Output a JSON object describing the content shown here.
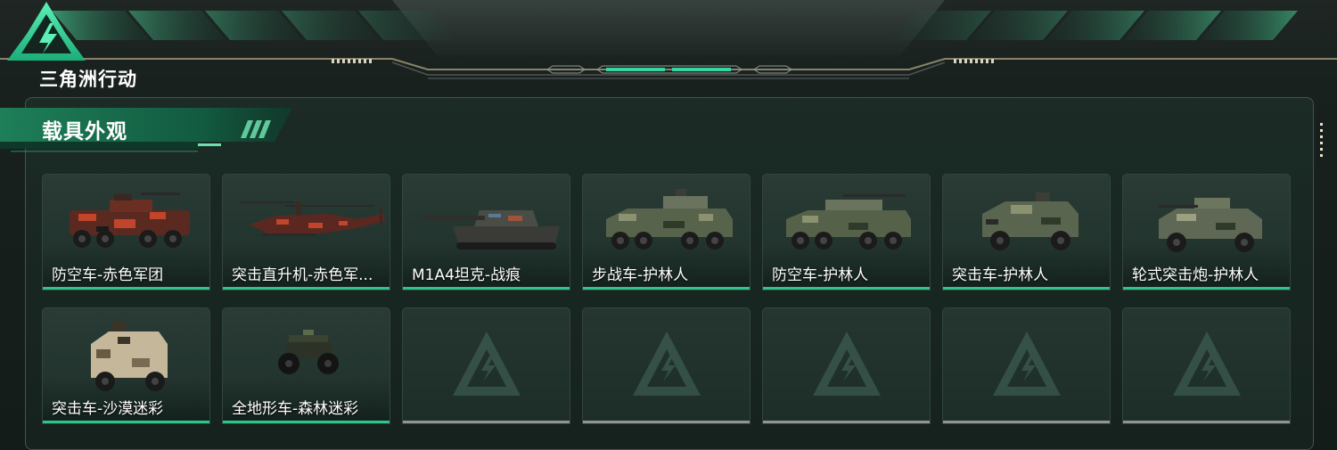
{
  "game": {
    "logo_text": "三角洲行动"
  },
  "section": {
    "title": "载具外观"
  },
  "colors": {
    "accent": "#2ec48a",
    "empty_bar": "#8f9593"
  },
  "skins": [
    {
      "label": "防空车-赤色军团",
      "icon": "aa-vehicle-red-camo",
      "empty": false
    },
    {
      "label": "突击直升机-赤色军...",
      "icon": "attack-helicopter-red-camo",
      "empty": false
    },
    {
      "label": "M1A4坦克-战痕",
      "icon": "m1a4-tank",
      "empty": false
    },
    {
      "label": "步战车-护林人",
      "icon": "ifv-forest-camo",
      "empty": false
    },
    {
      "label": "防空车-护林人",
      "icon": "aa-vehicle-forest-camo",
      "empty": false
    },
    {
      "label": "突击车-护林人",
      "icon": "assault-vehicle-forest-camo",
      "empty": false
    },
    {
      "label": "轮式突击炮-护林人",
      "icon": "wheeled-assault-gun-forest-camo",
      "empty": false
    },
    {
      "label": "突击车-沙漠迷彩",
      "icon": "assault-vehicle-desert-camo",
      "empty": false
    },
    {
      "label": "全地形车-森林迷彩",
      "icon": "atv-forest-camo",
      "empty": false
    },
    {
      "label": "",
      "icon": "empty-slot",
      "empty": true
    },
    {
      "label": "",
      "icon": "empty-slot",
      "empty": true
    },
    {
      "label": "",
      "icon": "empty-slot",
      "empty": true
    },
    {
      "label": "",
      "icon": "empty-slot",
      "empty": true
    },
    {
      "label": "",
      "icon": "empty-slot",
      "empty": true
    }
  ]
}
